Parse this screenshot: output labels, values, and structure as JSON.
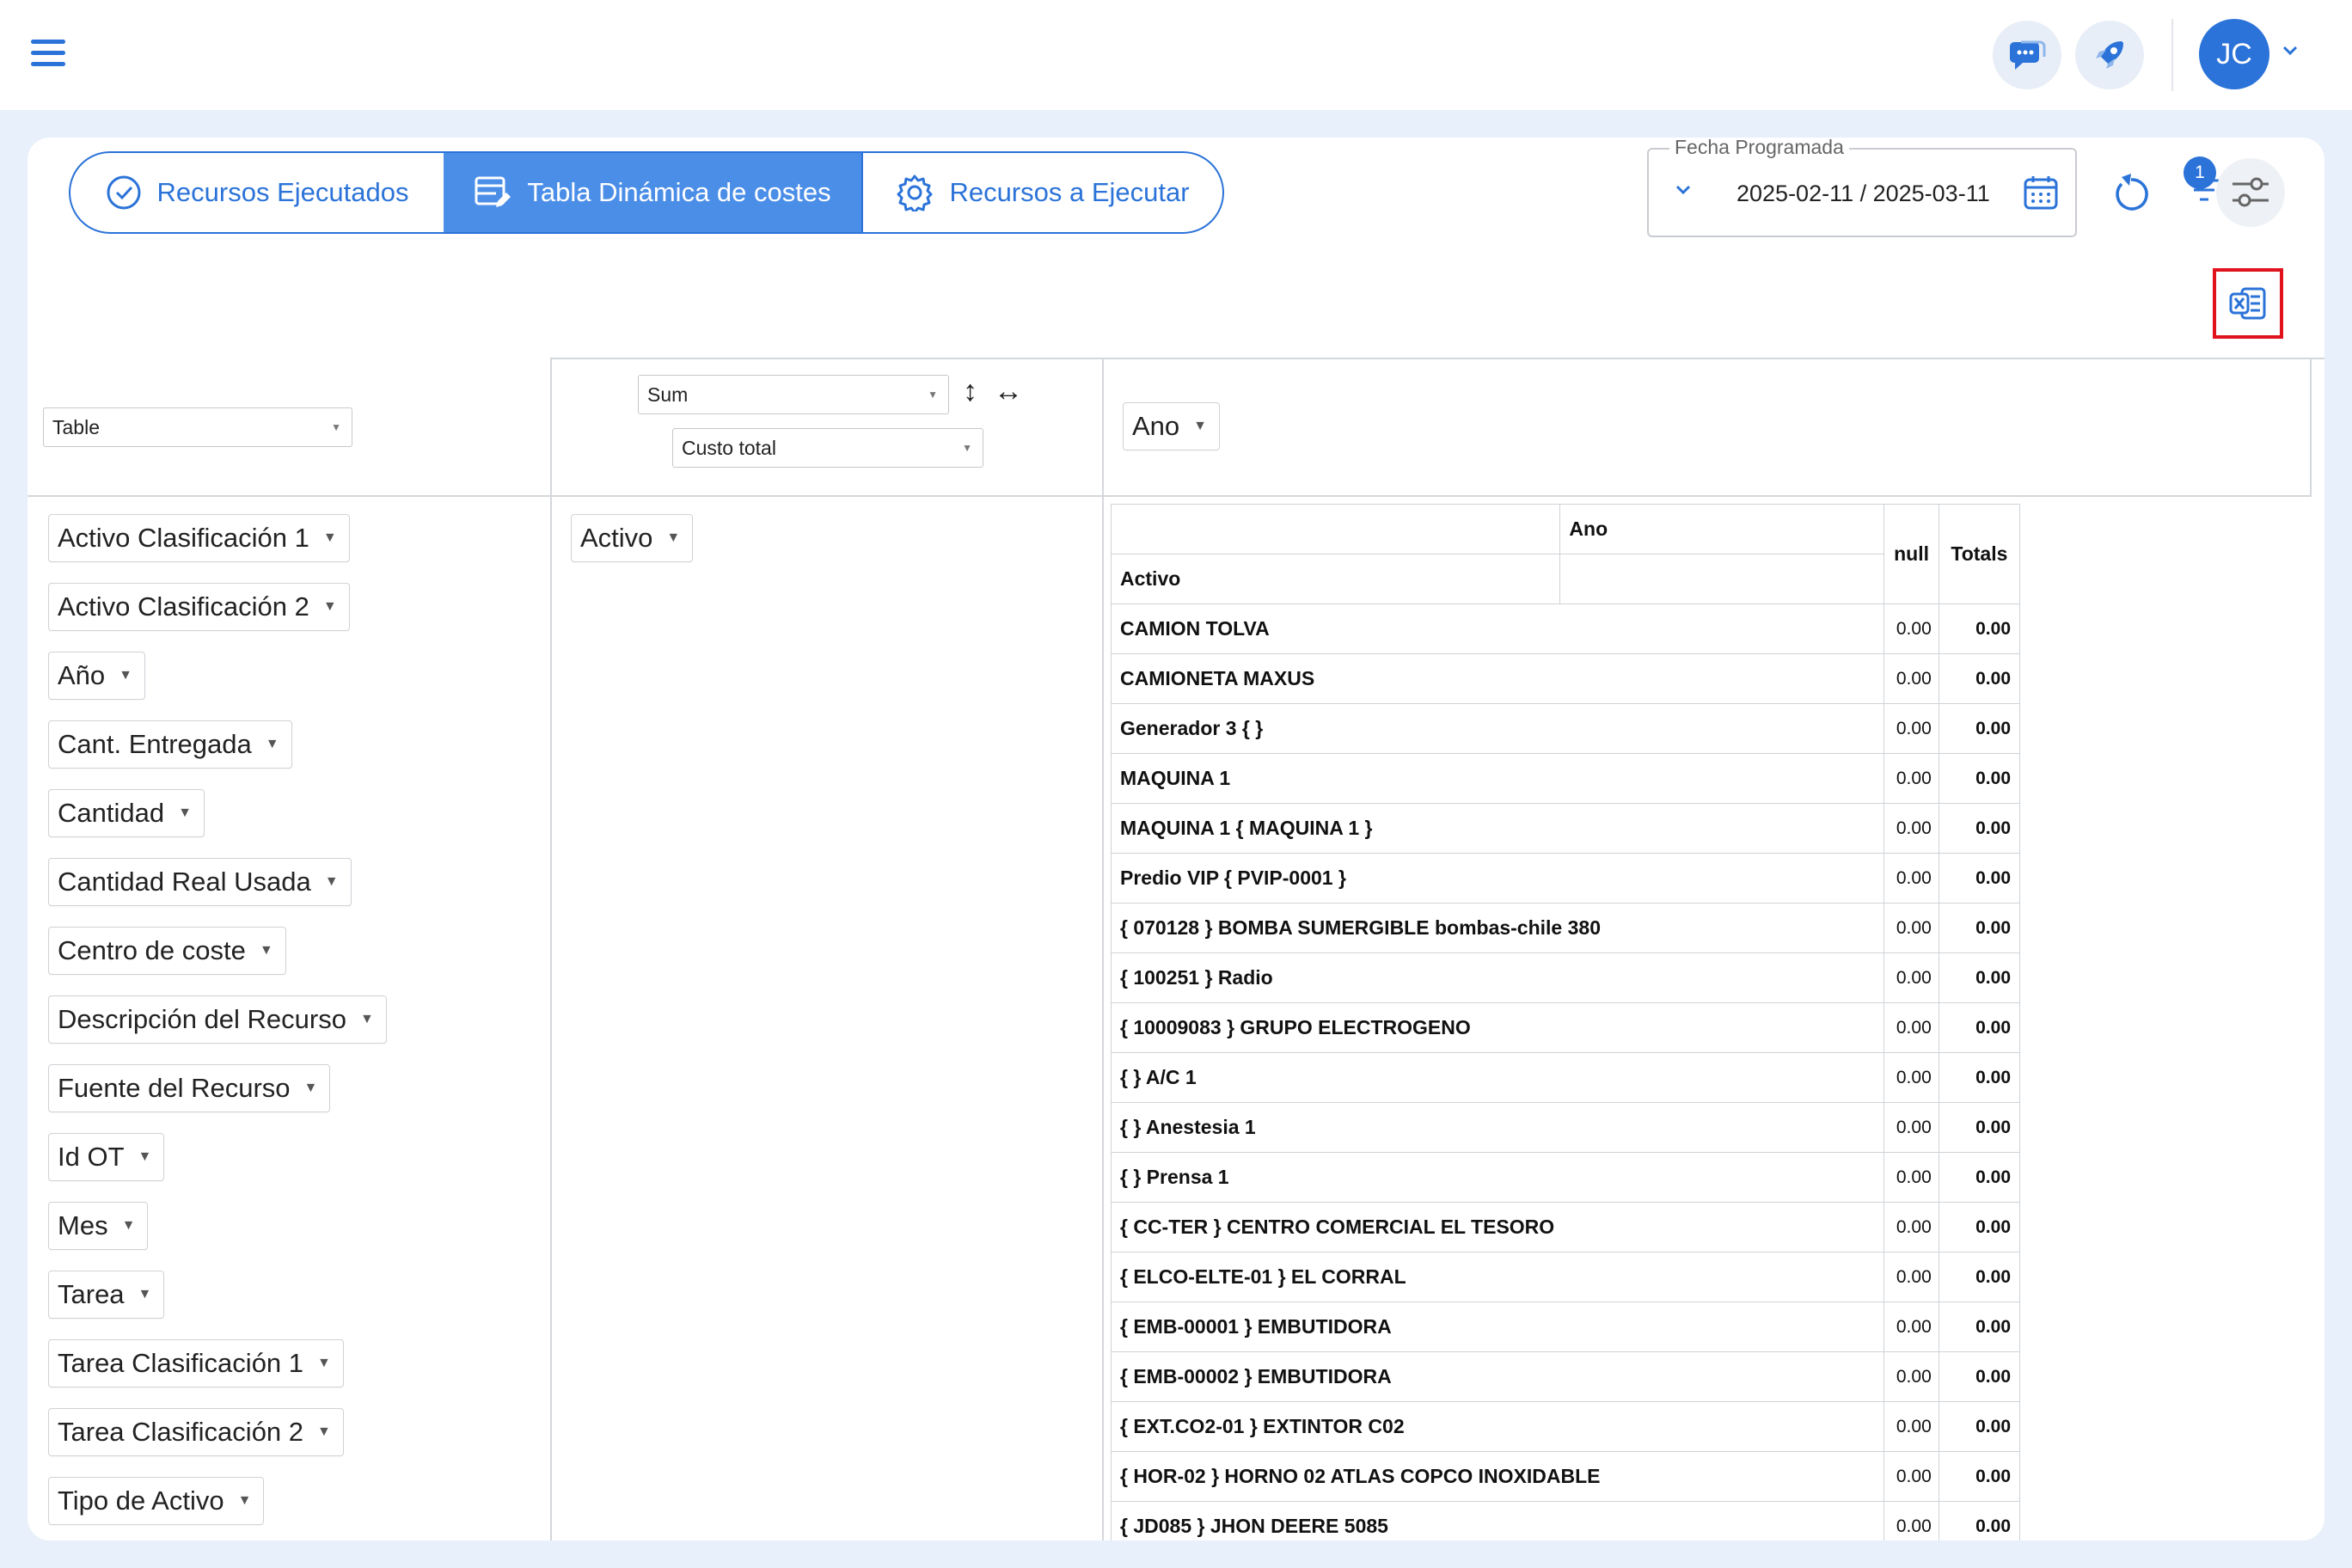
{
  "header": {
    "avatar_initials": "JC"
  },
  "tabs": [
    {
      "label": "Recursos Ejecutados",
      "icon": "check-circle-icon"
    },
    {
      "label": "Tabla Dinámica de costes",
      "icon": "table-edit-icon",
      "active": true
    },
    {
      "label": "Recursos a Ejecutar",
      "icon": "gear-icon"
    }
  ],
  "date_filter": {
    "legend": "Fecha Programada",
    "value": "2025-02-11 / 2025-03-11"
  },
  "filter_badge": "1",
  "pivot": {
    "renderer": "Table",
    "aggregator": "Sum",
    "aggregator_field": "Custo total",
    "column_field": "Ano",
    "row_field": "Activo",
    "unused_fields": [
      "Activo Clasificación 1",
      "Activo Clasificación 2",
      "Año",
      "Cant. Entregada",
      "Cantidad",
      "Cantidad Real Usada",
      "Centro de coste",
      "Descripción del Recurso",
      "Fuente del Recurso",
      "Id OT",
      "Mes",
      "Tarea",
      "Tarea Clasificación 1",
      "Tarea Clasificación 2",
      "Tipo de Activo"
    ],
    "table": {
      "col_header": "Ano",
      "row_header": "Activo",
      "null_header": "null",
      "totals_header": "Totals",
      "rows": [
        {
          "label": "CAMION TOLVA",
          "value": "0.00",
          "total": "0.00"
        },
        {
          "label": "CAMIONETA MAXUS",
          "value": "0.00",
          "total": "0.00"
        },
        {
          "label": "Generador 3 { }",
          "value": "0.00",
          "total": "0.00"
        },
        {
          "label": "MAQUINA 1",
          "value": "0.00",
          "total": "0.00"
        },
        {
          "label": "MAQUINA 1 { MAQUINA 1 }",
          "value": "0.00",
          "total": "0.00"
        },
        {
          "label": "Predio VIP { PVIP-0001 }",
          "value": "0.00",
          "total": "0.00"
        },
        {
          "label": "{ 070128 } BOMBA SUMERGIBLE bombas-chile 380",
          "value": "0.00",
          "total": "0.00"
        },
        {
          "label": "{ 100251 } Radio",
          "value": "0.00",
          "total": "0.00"
        },
        {
          "label": "{ 10009083 } GRUPO ELECTROGENO",
          "value": "0.00",
          "total": "0.00"
        },
        {
          "label": "{ } A/C 1",
          "value": "0.00",
          "total": "0.00"
        },
        {
          "label": "{ } Anestesia 1",
          "value": "0.00",
          "total": "0.00"
        },
        {
          "label": "{ } Prensa 1",
          "value": "0.00",
          "total": "0.00"
        },
        {
          "label": "{ CC-TER } CENTRO COMERCIAL EL TESORO",
          "value": "0.00",
          "total": "0.00"
        },
        {
          "label": "{ ELCO-ELTE-01 } EL CORRAL",
          "value": "0.00",
          "total": "0.00"
        },
        {
          "label": "{ EMB-00001 } EMBUTIDORA",
          "value": "0.00",
          "total": "0.00"
        },
        {
          "label": "{ EMB-00002 } EMBUTIDORA",
          "value": "0.00",
          "total": "0.00"
        },
        {
          "label": "{ EXT.CO2-01 } EXTINTOR C02",
          "value": "0.00",
          "total": "0.00"
        },
        {
          "label": "{ HOR-02 } HORNO 02 ATLAS COPCO INOXIDABLE",
          "value": "0.00",
          "total": "0.00"
        },
        {
          "label": "{ JD085 } JHON DEERE 5085",
          "value": "0.00",
          "total": "0.00"
        }
      ]
    }
  },
  "colors": {
    "accent": "#2b73d8",
    "active_tab": "#4b8ee8",
    "highlight": "#e0121c",
    "page_bg": "#e8f0fb"
  }
}
